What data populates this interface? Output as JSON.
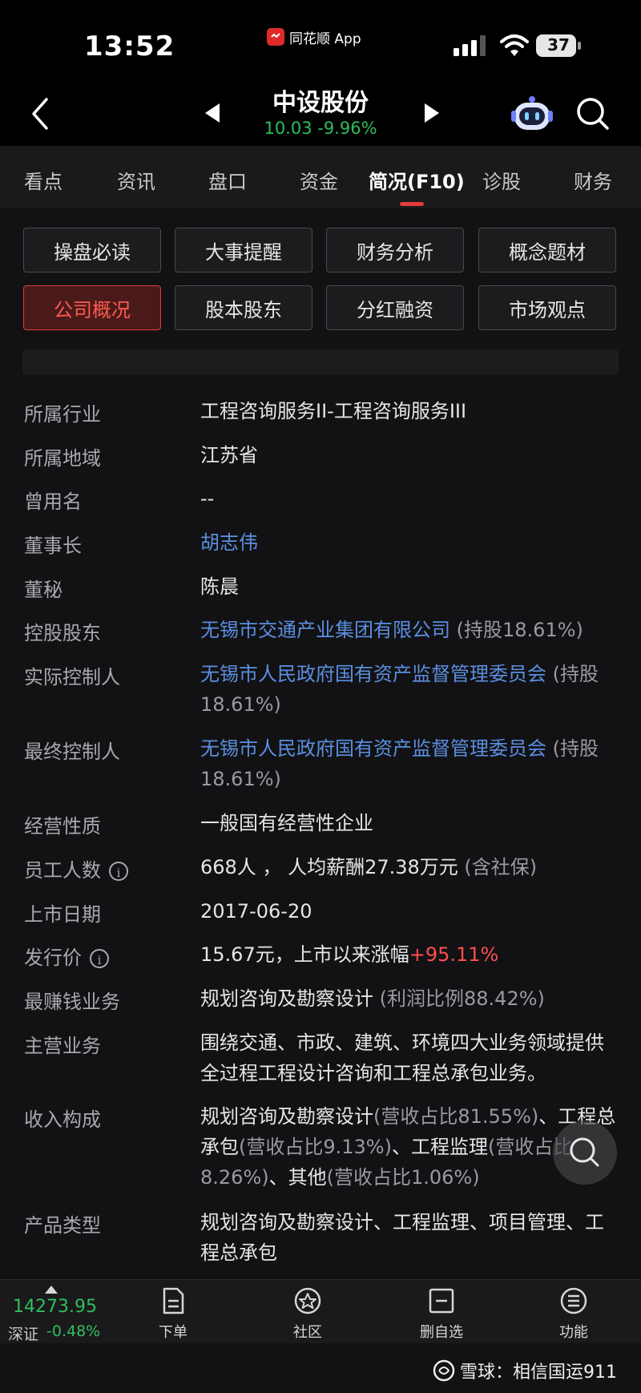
{
  "status_bar": {
    "time": "13:52",
    "app_name": "同花顺 App",
    "battery": "37"
  },
  "header": {
    "stock_name": "中设股份",
    "quote": "10.03 -9.96%"
  },
  "tabs": [
    {
      "label": "看点"
    },
    {
      "label": "资讯"
    },
    {
      "label": "盘口"
    },
    {
      "label": "资金"
    },
    {
      "label": "简况(F10)",
      "active": true
    },
    {
      "label": "诊股"
    },
    {
      "label": "财务"
    }
  ],
  "buttons": [
    {
      "label": "操盘必读"
    },
    {
      "label": "大事提醒"
    },
    {
      "label": "财务分析"
    },
    {
      "label": "概念题材"
    },
    {
      "label": "公司概况",
      "active": true
    },
    {
      "label": "股本股东"
    },
    {
      "label": "分红融资"
    },
    {
      "label": "市场观点"
    }
  ],
  "info": {
    "industry": {
      "label": "所属行业",
      "value": "工程咨询服务II-工程咨询服务III"
    },
    "region": {
      "label": "所属地域",
      "value": "江苏省"
    },
    "former_name": {
      "label": "曾用名",
      "value": "--"
    },
    "chairman": {
      "label": "董事长",
      "value": "胡志伟"
    },
    "secretary": {
      "label": "董秘",
      "value": "陈晨"
    },
    "controlling": {
      "label": "控股股东",
      "value": "无锡市交通产业集团有限公司",
      "note": "(持股18.61%)"
    },
    "actual_controller": {
      "label": "实际控制人",
      "value": "无锡市人民政府国有资产监督管理委员会",
      "note": "(持股18.61%)"
    },
    "ultimate_controller": {
      "label": "最终控制人",
      "value": "无锡市人民政府国有资产监督管理委员会",
      "note": "(持股18.61%)"
    },
    "nature": {
      "label": "经营性质",
      "value": "一般国有经营性企业"
    },
    "employees": {
      "label": "员工人数",
      "value": "668人 ， 人均薪酬27.38万元",
      "note": "(含社保)"
    },
    "listing_date": {
      "label": "上市日期",
      "value": "2017-06-20"
    },
    "issue_price": {
      "label": "发行价",
      "value": "15.67元，上市以来涨幅",
      "change": "+95.11%"
    },
    "top_business": {
      "label": "最赚钱业务",
      "value": "规划咨询及勘察设计",
      "note": "(利润比例88.42%)"
    },
    "main_business": {
      "label": "主营业务",
      "value": "围绕交通、市政、建筑、环境四大业务领域提供全过程工程设计咨询和工程总承包业务。"
    },
    "revenue": {
      "label": "收入构成",
      "parts": [
        {
          "name": "规划咨询及勘察设计",
          "note": "(营收占比81.55%)",
          "sep": "、"
        },
        {
          "name": "工程总承包",
          "note": "(营收占比9.13%)",
          "sep": "、"
        },
        {
          "name": "工程监理",
          "note": "(营收占比8.26%)",
          "sep": "、"
        },
        {
          "name": "其他",
          "note": "(营收占比1.06%)",
          "sep": ""
        }
      ]
    },
    "product_type": {
      "label": "产品类型",
      "value": "规划咨询及勘察设计、工程监理、项目管理、工程总承包"
    }
  },
  "index": {
    "value": "14273.95",
    "name": "深证",
    "change": "-0.48%"
  },
  "bottom_nav": [
    {
      "label": "下单",
      "icon": "order-icon"
    },
    {
      "label": "社区",
      "icon": "community-icon"
    },
    {
      "label": "删自选",
      "icon": "remove-watchlist-icon"
    },
    {
      "label": "功能",
      "icon": "menu-icon"
    }
  ],
  "watermark": "雪球：相信国运911",
  "colors": {
    "up_red": "#ff4e4e",
    "down_green": "#2fbe5b",
    "link_blue": "#5b8fe0",
    "accent": "#e23b3b"
  }
}
